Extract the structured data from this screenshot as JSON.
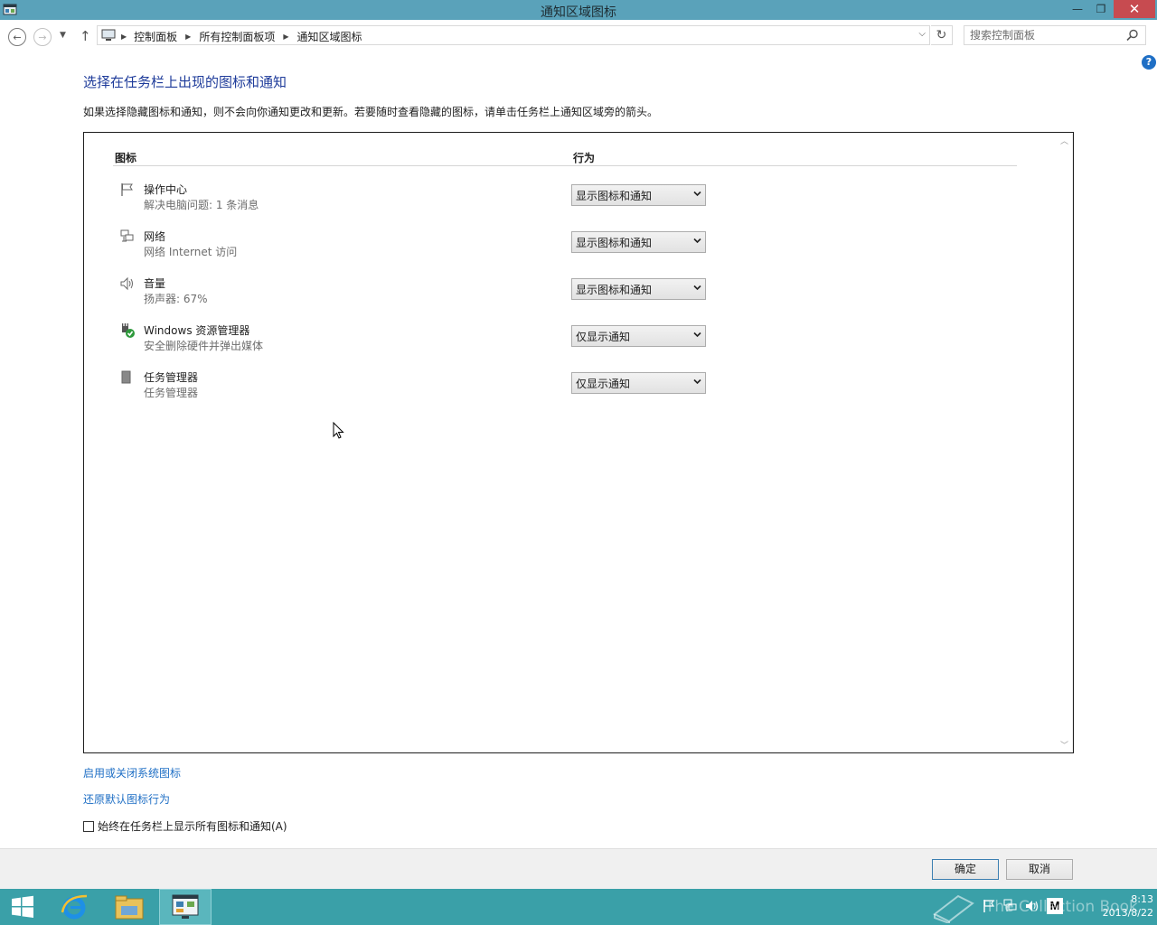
{
  "window": {
    "title": "通知区域图标",
    "minimize_glyph": "—",
    "maximize_glyph": "❐",
    "close_glyph": "✕"
  },
  "address_bar": {
    "crumbs": [
      "控制面板",
      "所有控制面板项",
      "通知区域图标"
    ],
    "search_placeholder": "搜索控制面板"
  },
  "help_glyph": "?",
  "main": {
    "heading": "选择在任务栏上出现的图标和通知",
    "description": "如果选择隐藏图标和通知，则不会向你通知更改和更新。若要随时查看隐藏的图标，请单击任务栏上通知区域旁的箭头。",
    "columns": {
      "icon": "图标",
      "behavior": "行为"
    },
    "rows": [
      {
        "name": "操作中心",
        "sub": "解决电脑问题: 1 条消息",
        "behavior": "显示图标和通知",
        "icon": "flag-icon"
      },
      {
        "name": "网络",
        "sub": "网络 Internet 访问",
        "behavior": "显示图标和通知",
        "icon": "network-icon"
      },
      {
        "name": "音量",
        "sub": "扬声器: 67%",
        "behavior": "显示图标和通知",
        "icon": "speaker-icon"
      },
      {
        "name": "Windows 资源管理器",
        "sub": "安全删除硬件并弹出媒体",
        "behavior": "仅显示通知",
        "icon": "usb-eject-icon"
      },
      {
        "name": "任务管理器",
        "sub": "任务管理器",
        "behavior": "仅显示通知",
        "icon": "task-manager-icon"
      }
    ]
  },
  "links": {
    "system_icons": "启用或关闭系统图标",
    "restore_default": "还原默认图标行为"
  },
  "always_show": {
    "label": "始终在任务栏上显示所有图标和通知(A)",
    "checked": false
  },
  "buttons": {
    "ok": "确定",
    "cancel": "取消"
  },
  "taskbar": {
    "apps": [
      "start-icon",
      "internet-explorer-icon",
      "file-explorer-icon",
      "control-panel-icon"
    ],
    "tray_icons": [
      "flag-icon",
      "network-icon",
      "speaker-icon",
      "ime-icon"
    ],
    "ime_label": "M",
    "time": "8:13",
    "date": "2013/8/22"
  },
  "watermark": "The Collection Book",
  "colors": {
    "titlebar": "#5aa2ba",
    "close": "#c74b50",
    "heading": "#1e3b9a",
    "link": "#1f6fc5",
    "taskbar": "#3aa0a8"
  }
}
